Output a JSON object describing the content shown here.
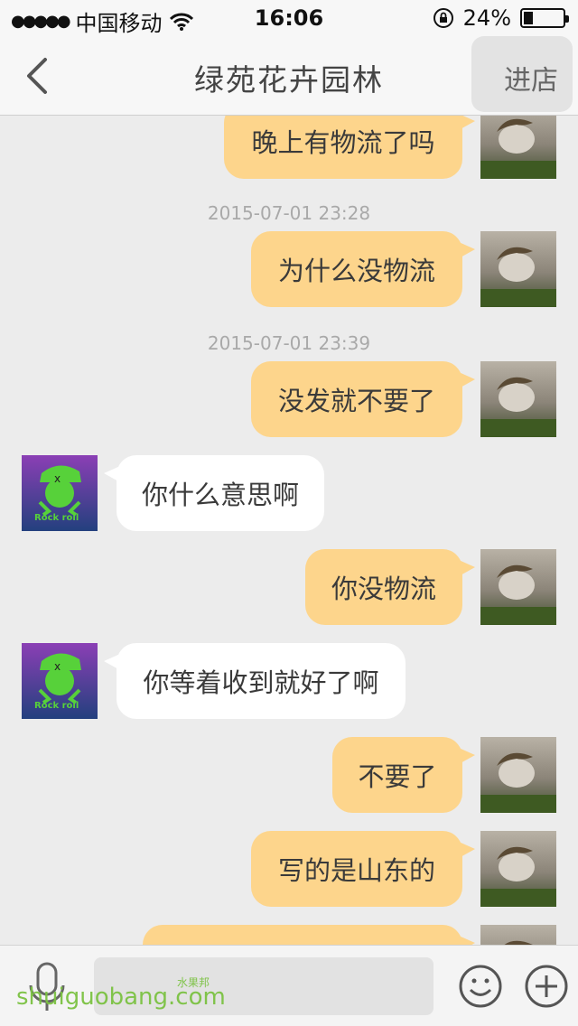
{
  "status_bar": {
    "carrier": "中国移动",
    "time": "16:06",
    "battery": "24%",
    "battery_level": 0.24,
    "icons": [
      "signal-dots-icon",
      "wifi-icon",
      "rotation-lock-icon",
      "battery-icon"
    ]
  },
  "nav": {
    "title": "绿苑花卉园林",
    "back_icon": "chevron-left-icon",
    "enter_shop_label": "进店"
  },
  "messages": [
    {
      "sender": "me",
      "text": "晚上有物流了吗"
    },
    {
      "timestamp": "2015-07-01 23:28"
    },
    {
      "sender": "me",
      "text": "为什么没物流"
    },
    {
      "timestamp": "2015-07-01 23:39"
    },
    {
      "sender": "me",
      "text": "没发就不要了"
    },
    {
      "sender": "other",
      "text": "你什么意思啊"
    },
    {
      "sender": "me",
      "text": "你没物流"
    },
    {
      "sender": "other",
      "text": "你等着收到就好了啊"
    },
    {
      "sender": "me",
      "text": "不要了"
    },
    {
      "sender": "me",
      "text": "写的是山东的"
    },
    {
      "sender": "me",
      "text": ""
    }
  ],
  "other_avatar_text": "Rock roll",
  "input_bar": {
    "input_value": "",
    "icons": [
      "microphone-icon",
      "emoji-icon",
      "plus-icon"
    ]
  },
  "watermark": {
    "text": "shuiguobang.com",
    "sub": "水果邦"
  },
  "colors": {
    "my_bubble": "#fdd58c",
    "other_bubble": "#ffffff",
    "background": "#ececec"
  }
}
